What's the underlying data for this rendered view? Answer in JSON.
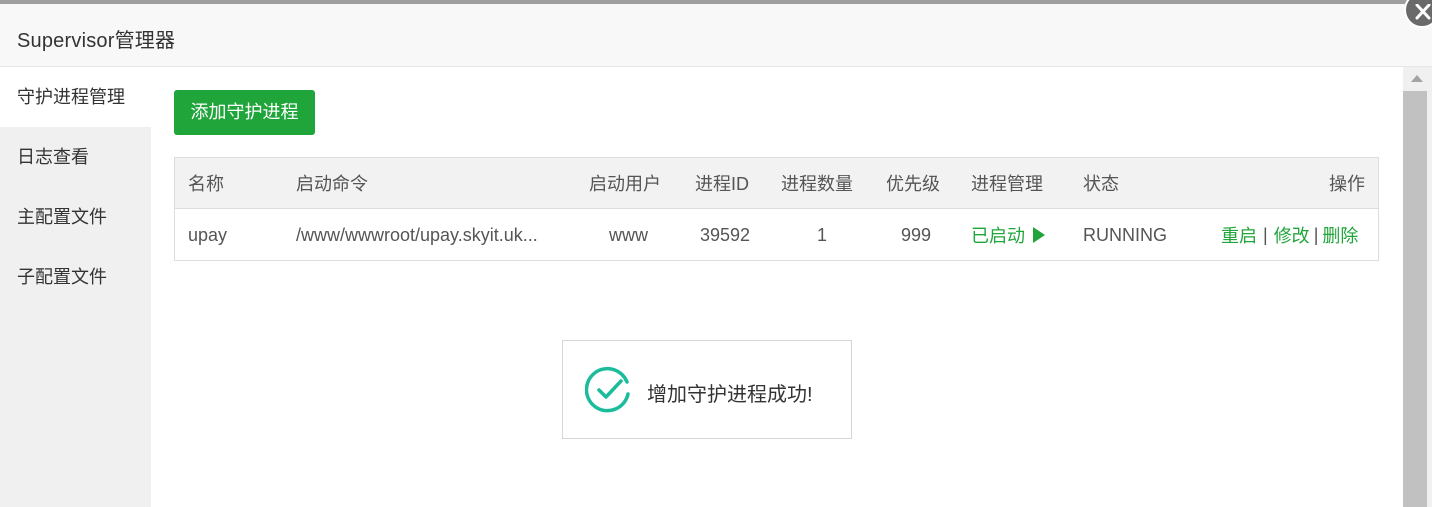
{
  "window": {
    "title": "Supervisor管理器"
  },
  "icons": {
    "close": "close-icon",
    "success": "check-circle-icon",
    "play": "play-icon"
  },
  "colors": {
    "accent": "#20a53a",
    "toast_icon": "#1abc9c",
    "close_bg": "#6a6a6a"
  },
  "sidebar": {
    "items": [
      {
        "label": "守护进程管理",
        "active": true
      },
      {
        "label": "日志查看",
        "active": false
      },
      {
        "label": "主配置文件",
        "active": false
      },
      {
        "label": "子配置文件",
        "active": false
      }
    ]
  },
  "toolbar": {
    "add_label": "添加守护进程"
  },
  "table": {
    "columns": [
      "名称",
      "启动命令",
      "启动用户",
      "进程ID",
      "进程数量",
      "优先级",
      "进程管理",
      "状态",
      "操作"
    ],
    "rows": [
      {
        "name": "upay",
        "command": "/www/wwwroot/upay.skyit.uk...",
        "user": "www",
        "pid": "39592",
        "count": "1",
        "priority": "999",
        "manage": "已启动",
        "status": "RUNNING",
        "actions": {
          "restart": "重启",
          "sep1": "|",
          "edit": "修改",
          "sep2": "|",
          "delete": "删除"
        }
      }
    ]
  },
  "toast": {
    "message": "增加守护进程成功!"
  }
}
